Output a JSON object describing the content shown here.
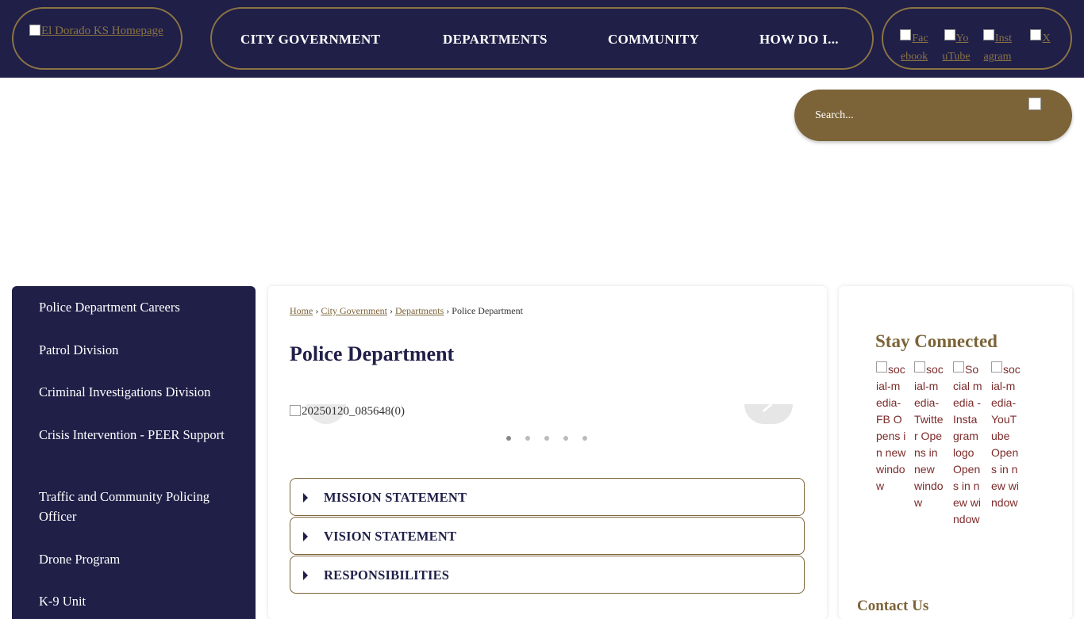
{
  "header": {
    "logo_alt": "El Dorado KS Homepage",
    "nav": [
      {
        "label": "CITY GOVERNMENT"
      },
      {
        "label": "DEPARTMENTS"
      },
      {
        "label": "COMMUNITY"
      },
      {
        "label": "HOW DO I..."
      }
    ],
    "social": [
      {
        "label": "Facebook"
      },
      {
        "label": "YouTube"
      },
      {
        "label": "Instagram"
      },
      {
        "label": "X"
      }
    ]
  },
  "search": {
    "placeholder": "Search...",
    "value": ""
  },
  "sidebar": {
    "items": [
      {
        "label": "Police Department Careers"
      },
      {
        "label": "Patrol Division"
      },
      {
        "label": "Criminal Investigations Division"
      },
      {
        "label": "Crisis Intervention - PEER Support"
      },
      {
        "label": "Traffic and Community Policing Officer"
      },
      {
        "label": "Drone Program"
      },
      {
        "label": "K-9 Unit"
      }
    ]
  },
  "main": {
    "breadcrumb": {
      "links": [
        "Home",
        "City Government",
        "Departments"
      ],
      "separator": "›",
      "current": "Police Department"
    },
    "title": "Police Department",
    "slideshow": {
      "image_alt": "20250120_085648(0)",
      "slide_count": 5,
      "active_index": 0
    },
    "accordions": [
      {
        "label": "MISSION STATEMENT"
      },
      {
        "label": "VISION STATEMENT"
      },
      {
        "label": "RESPONSIBILITIES"
      }
    ]
  },
  "right": {
    "stay_title": "Stay Connected",
    "social_images": [
      {
        "alt": "social-media-FB Opens in new window"
      },
      {
        "alt": "social-media-Twitter Opens in new window"
      },
      {
        "alt": "Social media - Instagram logo Opens in new window"
      },
      {
        "alt": "social-media-YouTube Opens in new window"
      }
    ],
    "contact_title": "Contact Us"
  },
  "colors": {
    "navy": "#1f1f48",
    "gold": "#7c6438",
    "gold_border": "#8c7443"
  }
}
